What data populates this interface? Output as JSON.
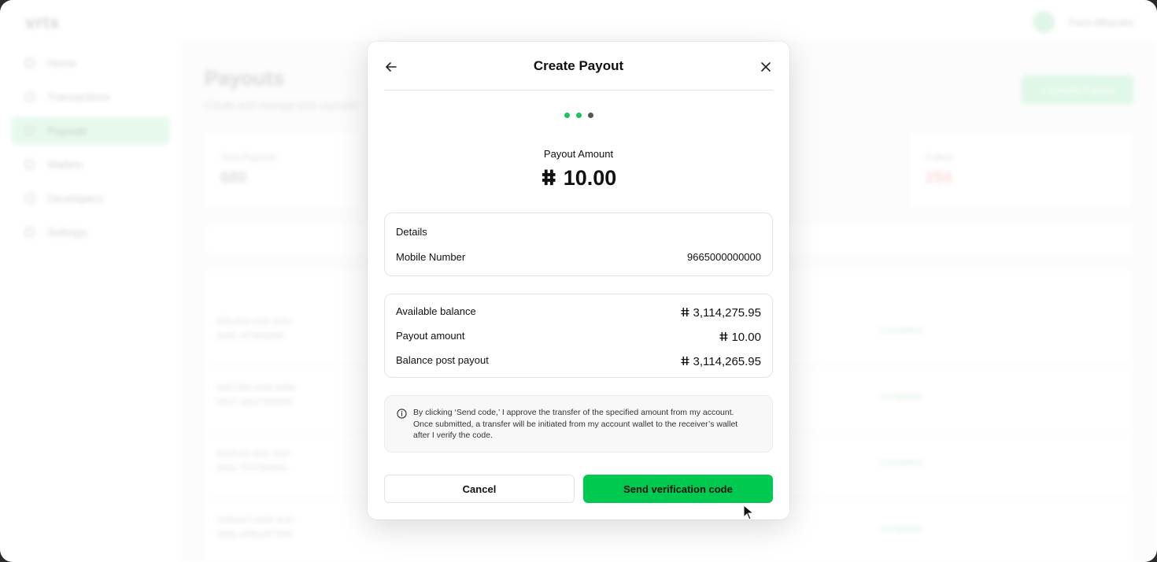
{
  "background": {
    "logo": "vrtx",
    "user_name": "Faris Alharaini",
    "nav": [
      "Home",
      "Transactions",
      "Payouts",
      "Wallets",
      "Developers",
      "Settings"
    ],
    "page_title": "Payouts",
    "page_subtitle": "Create and manage your payouts",
    "create_button": "+ Create Payout",
    "cards": [
      {
        "label": "Total Payouts",
        "value": "680"
      },
      {
        "label": "Failed",
        "value": "254"
      }
    ],
    "rows": [
      {
        "id": "0f5a4bd-c049 4a9c-8cd0 c87404ab8f",
        "status": "Completed"
      },
      {
        "id": "bd973b5-c548 4d9b-b537 3ab37f1f9285",
        "status": "Completed"
      },
      {
        "id": "964f7a0-4901 4dcf-8d2a 7f157f0ab6a",
        "status": "Completed"
      },
      {
        "id": "01f02a7f-4a69 4c2f-9dbb a4f6ae87f1b9",
        "status": "Completed"
      }
    ]
  },
  "modal": {
    "title": "Create Payout",
    "steps": [
      true,
      true,
      false
    ],
    "amount_label": "Payout Amount",
    "currency_symbol": "ⵌ",
    "amount": "10.00",
    "details": {
      "heading": "Details",
      "mobile_label": "Mobile Number",
      "mobile_value": "9665000000000"
    },
    "balance": {
      "available_label": "Available balance",
      "available_value": "3,114,275.95",
      "payout_label": "Payout amount",
      "payout_value": "10.00",
      "post_label": "Balance post payout",
      "post_value": "3,114,265.95"
    },
    "notice": "By clicking ‘Send code,’ I approve the transfer of the specified amount from my account. Once submitted, a transfer will be initiated from my account wallet to the receiver’s wallet after I verify the code.",
    "cancel_label": "Cancel",
    "send_label": "Send verification code"
  },
  "colors": {
    "accent": "#00c950",
    "step_active": "#19c45a",
    "step_inactive": "#555555"
  }
}
